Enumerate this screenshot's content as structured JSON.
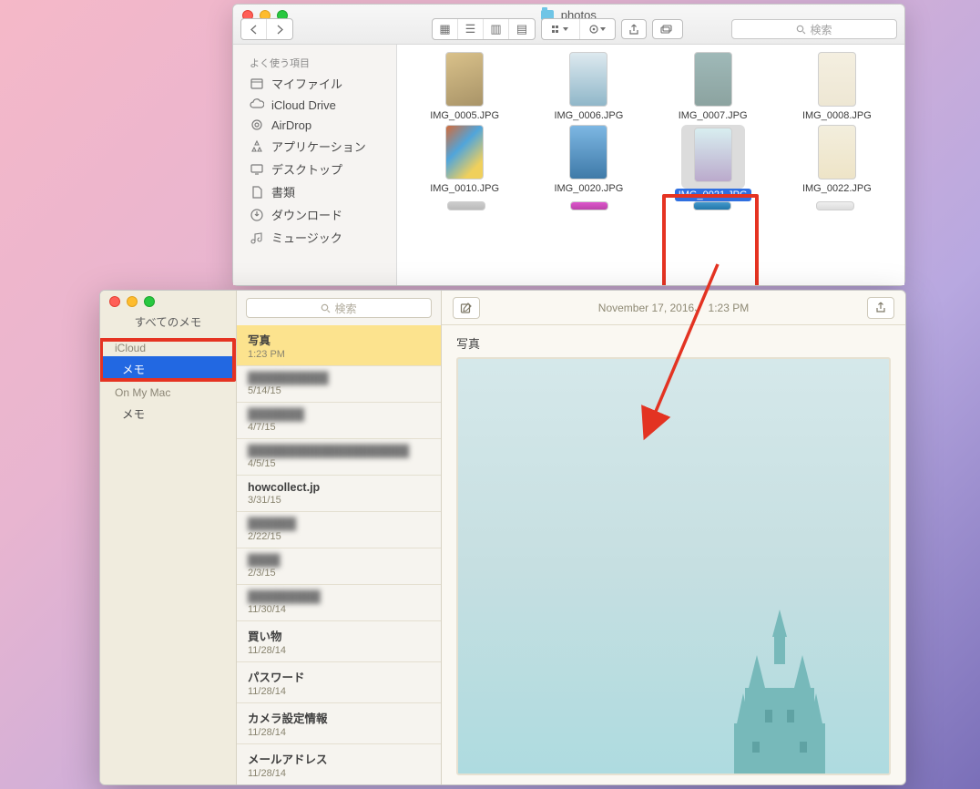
{
  "finder": {
    "title": "photos",
    "search_placeholder": "検索",
    "sidebar": {
      "header": "よく使う項目",
      "items": [
        {
          "icon": "my-files-icon",
          "label": "マイファイル"
        },
        {
          "icon": "icloud-icon",
          "label": "iCloud Drive"
        },
        {
          "icon": "airdrop-icon",
          "label": "AirDrop"
        },
        {
          "icon": "applications-icon",
          "label": "アプリケーション"
        },
        {
          "icon": "desktop-icon",
          "label": "デスクトップ"
        },
        {
          "icon": "documents-icon",
          "label": "書類"
        },
        {
          "icon": "downloads-icon",
          "label": "ダウンロード"
        },
        {
          "icon": "music-icon",
          "label": "ミュージック"
        }
      ]
    },
    "files": [
      {
        "name": "IMG_0005.JPG",
        "bg": "linear-gradient(160deg,#d9c18a,#a99468)"
      },
      {
        "name": "IMG_0006.JPG",
        "bg": "linear-gradient(#dde9ef,#90b7c9)"
      },
      {
        "name": "IMG_0007.JPG",
        "bg": "linear-gradient(#9fb9b8,#8ca3a0)"
      },
      {
        "name": "IMG_0008.JPG",
        "bg": "linear-gradient(#f4efe0,#eee7d4)"
      },
      {
        "name": "IMG_0010.JPG",
        "bg": "linear-gradient(135deg,#d26b3a,#50a5db 40%,#f0d05c 80%)"
      },
      {
        "name": "IMG_0020.JPG",
        "bg": "linear-gradient(#7db7e3,#3f7aa8)"
      },
      {
        "name": "IMG_0021.JPG",
        "bg": "linear-gradient(#d8eef0,#bac)",
        "selected": true
      },
      {
        "name": "IMG_0022.JPG",
        "bg": "linear-gradient(#f3eedd,#eee4c7)"
      }
    ]
  },
  "notes": {
    "all_notes_label": "すべてのメモ",
    "search_placeholder": "検索",
    "folders": {
      "sections": [
        {
          "name": "iCloud",
          "items": [
            {
              "label": "メモ",
              "selected": true
            }
          ]
        },
        {
          "name": "On My Mac",
          "items": [
            {
              "label": "メモ"
            }
          ]
        }
      ]
    },
    "list": [
      {
        "title": "写真",
        "date": "1:23 PM",
        "selected": true
      },
      {
        "title": "██████████",
        "date": "5/14/15",
        "blur": true
      },
      {
        "title": "███████",
        "date": "4/7/15",
        "blur": true
      },
      {
        "title": "████████████████████",
        "date": "4/5/15",
        "blur": true
      },
      {
        "title": "howcollect.jp",
        "date": "3/31/15"
      },
      {
        "title": "██████",
        "date": "2/22/15",
        "blur": true
      },
      {
        "title": "████",
        "date": "2/3/15",
        "blur": true
      },
      {
        "title": "█████████",
        "date": "11/30/14",
        "blur": true
      },
      {
        "title": "買い物",
        "date": "11/28/14"
      },
      {
        "title": "パスワード",
        "date": "11/28/14"
      },
      {
        "title": "カメラ設定情報",
        "date": "11/28/14"
      },
      {
        "title": "メールアドレス",
        "date": "11/28/14"
      }
    ],
    "view": {
      "date": "November 17, 2016、 1:23 PM",
      "title": "写真"
    }
  }
}
